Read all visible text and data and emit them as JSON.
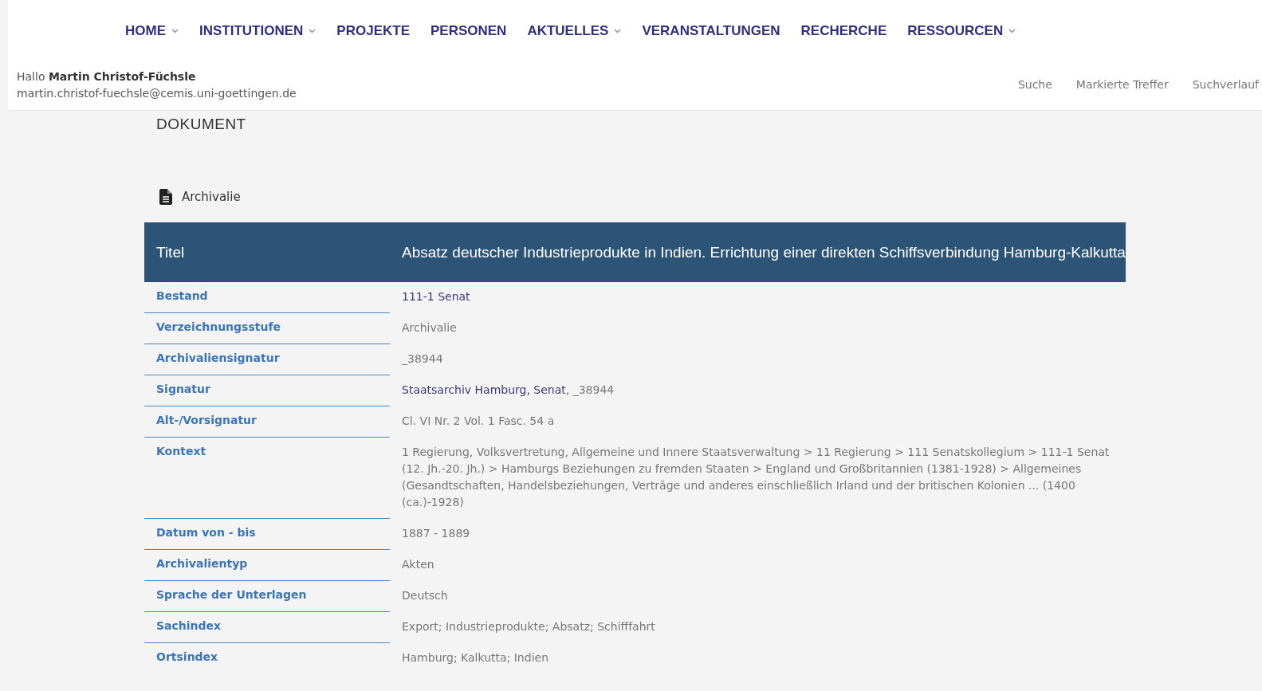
{
  "nav": [
    {
      "label": "HOME",
      "dropdown": true
    },
    {
      "label": "INSTITUTIONEN",
      "dropdown": true
    },
    {
      "label": "PROJEKTE",
      "dropdown": false
    },
    {
      "label": "PERSONEN",
      "dropdown": false
    },
    {
      "label": "AKTUELLES",
      "dropdown": true
    },
    {
      "label": "VERANSTALTUNGEN",
      "dropdown": false
    },
    {
      "label": "RECHERCHE",
      "dropdown": false
    },
    {
      "label": "RESSOURCEN",
      "dropdown": true
    }
  ],
  "user": {
    "greeting": "Hallo",
    "name": "Martin Christof-Füchsle",
    "email": "martin.christof-fuechsle@cemis.uni-goettingen.de"
  },
  "user_links": [
    "Suche",
    "Markierte Treffer",
    "Suchverlauf"
  ],
  "page_title": "DOKUMENT",
  "record_type": "Archivalie",
  "table": {
    "header": {
      "label": "Titel",
      "value": "Absatz deutscher Industrieprodukte in Indien. Errichtung einer direkten Schiffsverbindung Hamburg-Kalkutta"
    },
    "rows": [
      {
        "label": "Bestand",
        "parts": [
          {
            "text": "111-1 Senat",
            "link": true
          }
        ]
      },
      {
        "label": "Verzeichnungsstufe",
        "parts": [
          {
            "text": "Archivalie",
            "link": false
          }
        ]
      },
      {
        "label": "Archivaliensignatur",
        "parts": [
          {
            "text": "_38944",
            "link": false
          }
        ]
      },
      {
        "label": "Signatur",
        "parts": [
          {
            "text": "Staatsarchiv Hamburg, Senat",
            "link": true
          },
          {
            "text": ", _38944",
            "link": false
          }
        ]
      },
      {
        "label": "Alt-/Vorsignatur",
        "parts": [
          {
            "text": "Cl. VI Nr. 2 Vol. 1 Fasc. 54 a",
            "link": false
          }
        ]
      },
      {
        "label": "Kontext",
        "parts": [
          {
            "text": "1 Regierung, Volksvertretung, Allgemeine und Innere Staatsverwaltung > 11 Regierung > 111 Senatskollegium > 111-1 Senat (12. Jh.-20. Jh.) > Hamburgs Beziehungen zu fremden Staaten > England und Großbritannien (1381-1928) > Allgemeines (Gesandtschaften, Handelsbeziehungen, Verträge und anderes einschließlich Irland und der britischen Kolonien ... (1400 (ca.)-1928)",
            "link": false
          }
        ]
      },
      {
        "label": "Datum von - bis",
        "parts": [
          {
            "text": "1887 - 1889",
            "link": false
          }
        ]
      },
      {
        "label": "Archivalientyp",
        "parts": [
          {
            "text": "Akten",
            "link": false
          }
        ]
      },
      {
        "label": "Sprache der Unterlagen",
        "parts": [
          {
            "text": "Deutsch",
            "link": false
          }
        ]
      },
      {
        "label": "Sachindex",
        "parts": [
          {
            "text": "Export; Industrieprodukte; Absatz; Schifffahrt",
            "link": false
          }
        ]
      },
      {
        "label": "Ortsindex",
        "parts": [
          {
            "text": "Hamburg; Kalkutta; Indien",
            "link": false
          }
        ]
      }
    ]
  }
}
